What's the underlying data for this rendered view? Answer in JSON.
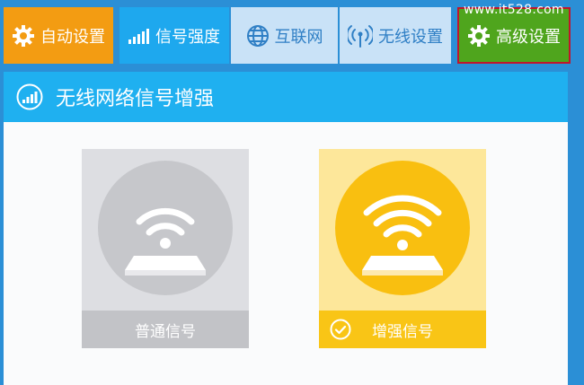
{
  "watermark": "www.it528.com",
  "tabs": {
    "auto": "自动设置",
    "signal": "信号强度",
    "internet": "互联网",
    "wireless": "无线设置",
    "advanced": "高级设置"
  },
  "section": {
    "title": "无线网络信号增强"
  },
  "modes": {
    "normal": {
      "label": "普通信号"
    },
    "boost": {
      "label": "增强信号",
      "selected": true
    }
  },
  "colors": {
    "page_bg": "#2b8fd6",
    "tab_auto": "#f39c12",
    "tab_signal": "#1ea8ee",
    "tab_inactive": "#c9e2f7",
    "tab_advanced": "#4fa51d",
    "highlight_border": "#c0152b",
    "header": "#1fb0f0",
    "boost_accent": "#f9bf10",
    "normal_gray": "#c6c7cb"
  }
}
